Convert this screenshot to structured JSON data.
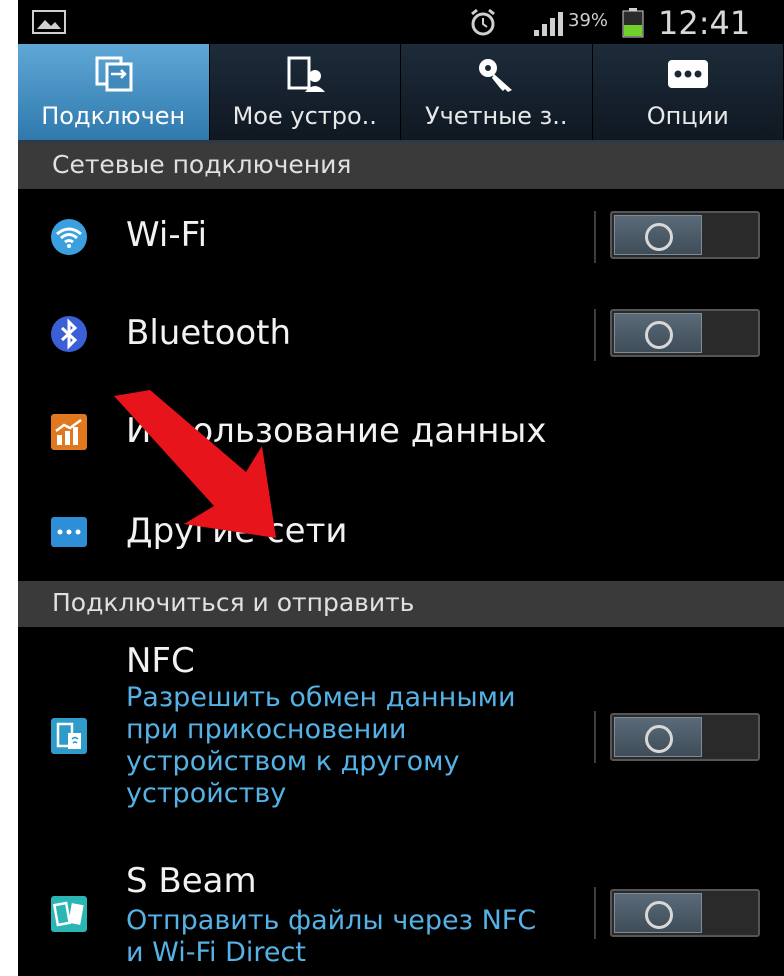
{
  "status_bar": {
    "battery_text": "39%",
    "time": "12:41",
    "icons": [
      "image-icon",
      "alarm-icon",
      "signal-icon",
      "battery-icon"
    ]
  },
  "tabs": [
    {
      "label": "Подключен",
      "icon": "connections-icon",
      "active": true
    },
    {
      "label": "Мое устро..",
      "icon": "my-device-icon",
      "active": false
    },
    {
      "label": "Учетные з..",
      "icon": "accounts-key-icon",
      "active": false
    },
    {
      "label": "Опции",
      "icon": "more-options-icon",
      "active": false
    }
  ],
  "sections": {
    "network": "Сетевые подключения",
    "connect_share": "Подключиться и отправить"
  },
  "items": {
    "wifi": {
      "title": "Wi-Fi",
      "icon": "wifi-icon",
      "toggle_on": false
    },
    "bluetooth": {
      "title": "Bluetooth",
      "icon": "bluetooth-icon",
      "toggle_on": false
    },
    "data_usage": {
      "title": "Использование данных",
      "icon": "data-usage-icon"
    },
    "other_networks": {
      "title": "Другие сети",
      "icon": "more-networks-icon"
    },
    "nfc": {
      "title": "NFC",
      "subtitle": "Разрешить обмен данными при прикосновении устройством к другому устройству",
      "icon": "nfc-icon",
      "toggle_on": false
    },
    "s_beam": {
      "title": "S Beam",
      "subtitle": "Отправить файлы через NFC и Wi-Fi Direct",
      "icon": "s-beam-icon",
      "toggle_on": false
    }
  },
  "colors": {
    "accent_blue": "#55b2e6",
    "annotation_arrow": "#e8141b"
  }
}
